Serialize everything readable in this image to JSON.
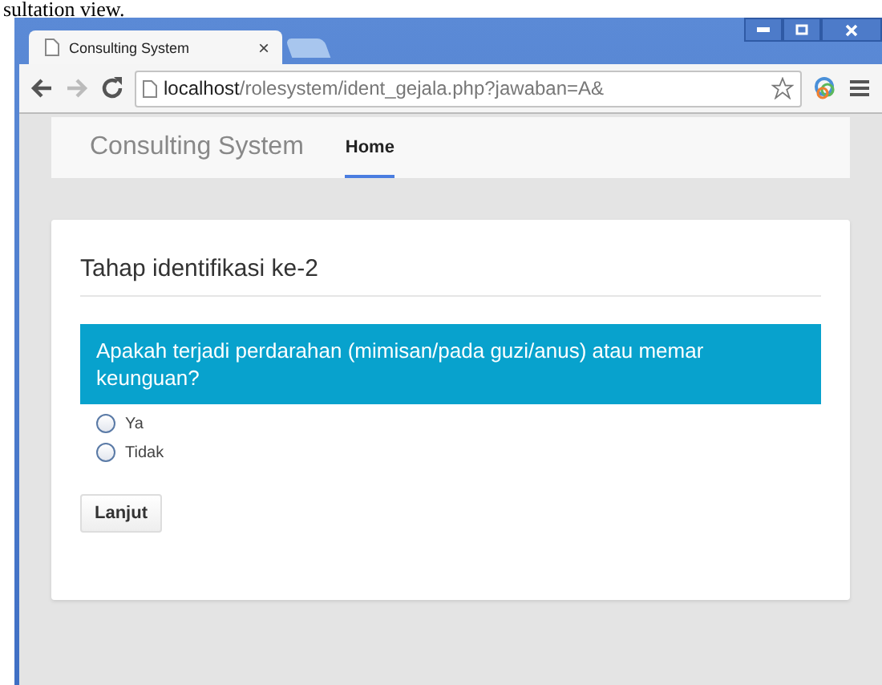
{
  "caption": "sultation view.",
  "browser": {
    "tabs": [
      {
        "title": "Consulting System",
        "selected": true,
        "close": "×"
      },
      {
        "selected": false
      }
    ],
    "address": {
      "host": "localhost",
      "path": "/rolesystem/ident_gejala.php?jawaban=A&"
    }
  },
  "navbar": {
    "brand": "Consulting System",
    "links": [
      {
        "label": "Home",
        "selected": true
      }
    ]
  },
  "card": {
    "title": "Tahap identifikasi ke-2",
    "question": "Apakah terjadi perdarahan (mimisan/pada guzi/anus) atau memar keunguan?",
    "options": [
      {
        "label": "Ya",
        "selected": false
      },
      {
        "label": "Tidak",
        "selected": false
      }
    ],
    "button": "Lanjut"
  }
}
